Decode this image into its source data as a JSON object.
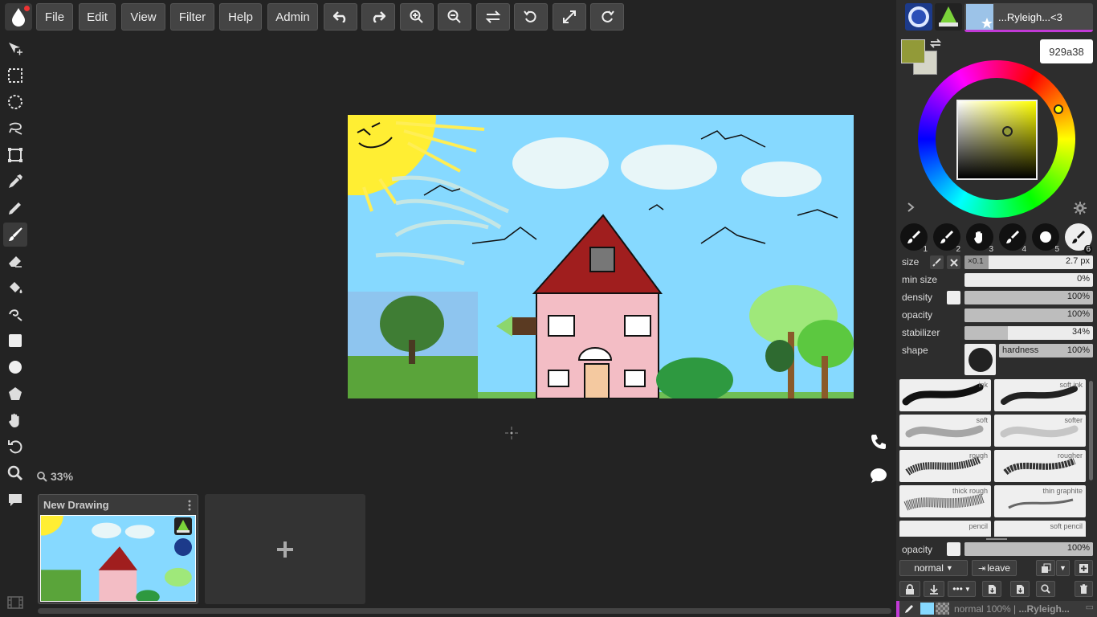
{
  "menu": {
    "file": "File",
    "edit": "Edit",
    "view": "View",
    "filter": "Filter",
    "help": "Help",
    "admin": "Admin"
  },
  "toolbar_icons": [
    "undo-icon",
    "redo-icon",
    "zoom-in-icon",
    "zoom-out-icon",
    "flip-icon",
    "rotate-ccw-icon",
    "fullscreen-icon",
    "rotate-cw-icon"
  ],
  "left_tools": [
    "move-tool-icon",
    "rect-select-icon",
    "ellipse-select-icon",
    "lasso-select-icon",
    "transform-icon",
    "eyedropper-icon",
    "pencil-icon",
    "brush-icon",
    "eraser-icon",
    "fill-bucket-icon",
    "blur-icon",
    "rectangle-icon",
    "ellipse-icon",
    "shape-icon",
    "hand-icon",
    "undo-rotate-icon",
    "zoom-icon",
    "comment-icon"
  ],
  "canvas": {
    "zoom": "33%"
  },
  "documents": [
    {
      "title": "New Drawing"
    }
  ],
  "user": {
    "name": "...Ryleigh...<3"
  },
  "color": {
    "primary": "#929a38",
    "secondary": "#d5d5c8",
    "hex_value": "929a38"
  },
  "presets": [
    "1",
    "2",
    "3",
    "4",
    "5",
    "6"
  ],
  "brush_settings": {
    "size_label": "size",
    "size_multiplier": "×0.1",
    "size_value": "2.7 px",
    "min_size_label": "min size",
    "min_size_value": "0%",
    "density_label": "density",
    "density_value": "100%",
    "opacity_label": "opacity",
    "opacity_value": "100%",
    "stabilizer_label": "stabilizer",
    "stabilizer_value": "34%",
    "shape_label": "shape",
    "hardness_label": "hardness",
    "hardness_value": "100%"
  },
  "brush_library": [
    "ink",
    "soft ink",
    "soft",
    "softer",
    "rough",
    "rougher",
    "thick rough",
    "thin graphite",
    "pencil",
    "soft pencil"
  ],
  "layer": {
    "opacity_label": "opacity",
    "opacity_value": "100%",
    "blend_mode": "normal",
    "leave_label": "leave",
    "status_text": "normal 100% |",
    "status_user": "...Ryleigh..."
  }
}
